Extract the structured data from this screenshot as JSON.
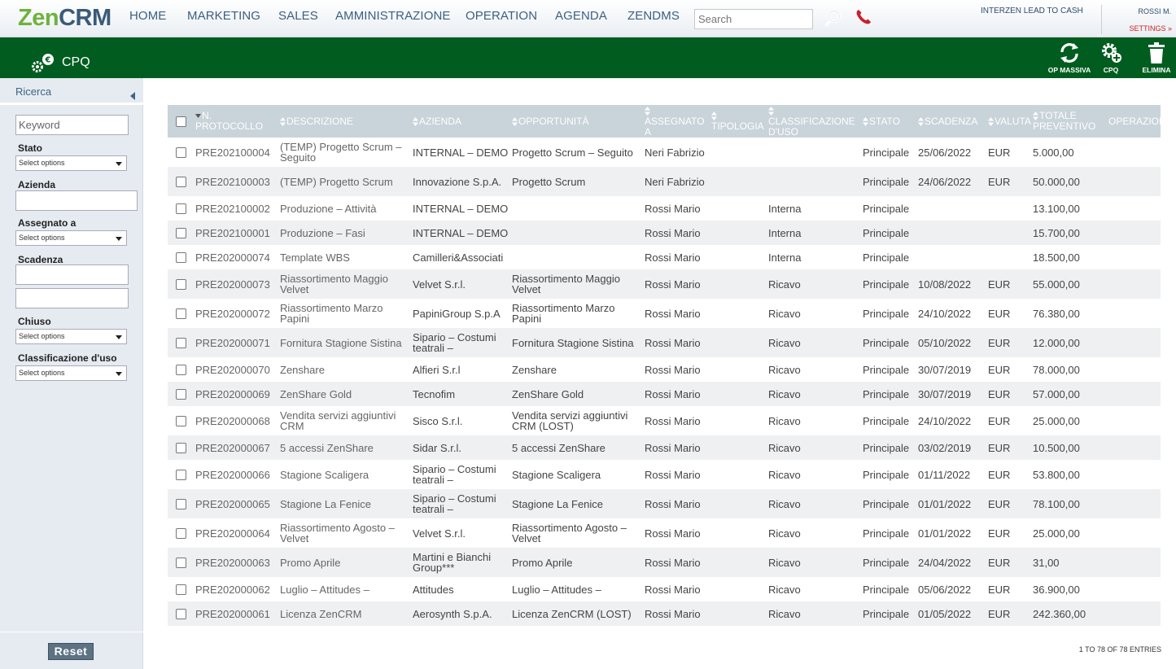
{
  "brand": {
    "zen": "Zen",
    "crm": "CRM"
  },
  "nav": {
    "items": [
      "HOME",
      "MARKETING",
      "SALES",
      "AMMINISTRAZIONE",
      "OPERATION",
      "AGENDA",
      "ZENDMS"
    ],
    "search_placeholder": "Search",
    "lead_to_cash": "INTERZEN LEAD TO CASH",
    "user": "ROSSI M.",
    "settings": "SETTINGS »"
  },
  "app": {
    "title": "CPQ",
    "tools": [
      "OP MASSIVA",
      "CPQ",
      "ELIMINA"
    ],
    "colors": {
      "header_green": "#005d1f",
      "nav_text": "#3c6080",
      "logo_green": "#6fb23c",
      "settings_red": "#cc2222"
    }
  },
  "sidebar": {
    "title": "Ricerca",
    "keyword_placeholder": "Keyword",
    "stato_label": "Stato",
    "stato_value": "Select options",
    "azienda_label": "Azienda",
    "assegnato_label": "Assegnato a",
    "assegnato_value": "Select options",
    "scadenza_label": "Scadenza",
    "chiuso_label": "Chiuso",
    "chiuso_value": "Select options",
    "classificazione_label": "Classificazione d'uso",
    "classificazione_value": "Select options",
    "reset": "Reset"
  },
  "table": {
    "columns": [
      "N. PROTOCOLLO",
      "DESCRIZIONE",
      "AZIENDA",
      "OPPORTUNITÀ",
      "ASSEGNATO A",
      "TIPOLOGIA",
      "CLASSIFICAZIONE D'USO",
      "STATO",
      "SCADENZA",
      "VALUTA",
      "TOTALE PREVENTIVO",
      "OPERAZIONI"
    ],
    "rows": [
      [
        "PRE202100004",
        "(TEMP) Progetto Scrum – Seguito",
        "INTERNAL – DEMO",
        "Progetto Scrum – Seguito",
        "Neri Fabrizio",
        "",
        "",
        "Principale",
        "25/06/2022",
        "EUR",
        "5.000,00",
        ""
      ],
      [
        "PRE202100003",
        "(TEMP) Progetto Scrum",
        "Innovazione S.p.A.",
        "Progetto Scrum",
        "Neri Fabrizio",
        "",
        "",
        "Principale",
        "24/06/2022",
        "EUR",
        "50.000,00",
        ""
      ],
      [
        "PRE202100002",
        "Produzione – Attività",
        "INTERNAL – DEMO",
        "",
        "Rossi Mario",
        "",
        "Interna",
        "Principale",
        "",
        "",
        "13.100,00",
        ""
      ],
      [
        "PRE202100001",
        "Produzione – Fasi",
        "INTERNAL – DEMO",
        "",
        "Rossi Mario",
        "",
        "Interna",
        "Principale",
        "",
        "",
        "15.700,00",
        ""
      ],
      [
        "PRE202000074",
        "Template WBS",
        "Camilleri&Associati",
        "",
        "Rossi Mario",
        "",
        "Interna",
        "Principale",
        "",
        "",
        "18.500,00",
        ""
      ],
      [
        "PRE202000073",
        "Riassortimento Maggio Velvet",
        "Velvet S.r.l.",
        "Riassortimento Maggio Velvet",
        "Rossi Mario",
        "",
        "Ricavo",
        "Principale",
        "10/08/2022",
        "EUR",
        "55.000,00",
        ""
      ],
      [
        "PRE202000072",
        "Riassortimento Marzo Papini",
        "PapiniGroup S.p.A",
        "Riassortimento Marzo Papini",
        "Rossi Mario",
        "",
        "Ricavo",
        "Principale",
        "24/10/2022",
        "EUR",
        "76.380,00",
        ""
      ],
      [
        "PRE202000071",
        "Fornitura Stagione Sistina",
        "Sipario – Costumi teatrali –",
        "Fornitura Stagione Sistina",
        "Rossi Mario",
        "",
        "Ricavo",
        "Principale",
        "05/10/2022",
        "EUR",
        "12.000,00",
        ""
      ],
      [
        "PRE202000070",
        "Zenshare",
        "Alfieri S.r.l",
        "Zenshare",
        "Rossi Mario",
        "",
        "Ricavo",
        "Principale",
        "30/07/2019",
        "EUR",
        "78.000,00",
        ""
      ],
      [
        "PRE202000069",
        "ZenShare Gold",
        "Tecnofim",
        "ZenShare Gold",
        "Rossi Mario",
        "",
        "Ricavo",
        "Principale",
        "30/07/2019",
        "EUR",
        "57.000,00",
        ""
      ],
      [
        "PRE202000068",
        "Vendita servizi aggiuntivi CRM",
        "Sisco S.r.l.",
        "Vendita servizi aggiuntivi CRM (LOST)",
        "Rossi Mario",
        "",
        "Ricavo",
        "Principale",
        "24/10/2022",
        "EUR",
        "25.000,00",
        ""
      ],
      [
        "PRE202000067",
        "5 accessi ZenShare",
        "Sidar S.r.l.",
        "5 accessi ZenShare",
        "Rossi Mario",
        "",
        "Ricavo",
        "Principale",
        "03/02/2019",
        "EUR",
        "10.500,00",
        ""
      ],
      [
        "PRE202000066",
        "Stagione Scaligera",
        "Sipario – Costumi teatrali –",
        "Stagione Scaligera",
        "Rossi Mario",
        "",
        "Ricavo",
        "Principale",
        "01/11/2022",
        "EUR",
        "53.800,00",
        ""
      ],
      [
        "PRE202000065",
        "Stagione La Fenice",
        "Sipario – Costumi teatrali –",
        "Stagione La Fenice",
        "Rossi Mario",
        "",
        "Ricavo",
        "Principale",
        "01/01/2022",
        "EUR",
        "78.100,00",
        ""
      ],
      [
        "PRE202000064",
        "Riassortimento Agosto – Velvet",
        "Velvet S.r.l.",
        "Riassortimento Agosto – Velvet",
        "Rossi Mario",
        "",
        "Ricavo",
        "Principale",
        "01/01/2022",
        "EUR",
        "25.000,00",
        ""
      ],
      [
        "PRE202000063",
        "Promo Aprile",
        "Martini e Bianchi Group***",
        "Promo Aprile",
        "Rossi Mario",
        "",
        "Ricavo",
        "Principale",
        "24/04/2022",
        "EUR",
        "31,00",
        ""
      ],
      [
        "PRE202000062",
        "Luglio – Attitudes –",
        "Attitudes",
        "Luglio – Attitudes –",
        "Rossi Mario",
        "",
        "Ricavo",
        "Principale",
        "05/06/2022",
        "EUR",
        "36.900,00",
        ""
      ],
      [
        "PRE202000061",
        "Licenza ZenCRM",
        "Aerosynth S.p.A.",
        "Licenza ZenCRM (LOST)",
        "Rossi Mario",
        "",
        "Ricavo",
        "Principale",
        "01/05/2022",
        "EUR",
        "242.360,00",
        ""
      ]
    ],
    "info": "1 TO 78 OF 78 ENTRIES"
  }
}
